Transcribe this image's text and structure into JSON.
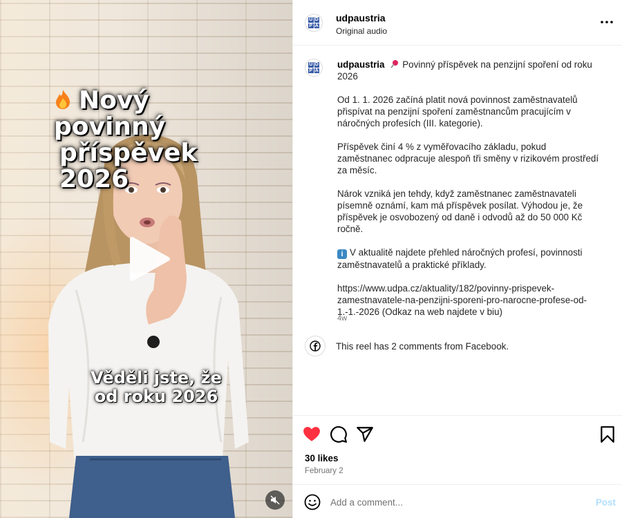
{
  "media": {
    "overlay_title_line1": "Nový povinný",
    "overlay_title_line2": "příspěvek 2026",
    "overlay_caption": "Věděli jste, že od roku 2026",
    "play_icon": "play-icon",
    "mute_icon": "muted-speaker-icon"
  },
  "header": {
    "username": "udpaustria",
    "audio": "Original audio",
    "avatar_letters": [
      "U",
      "D",
      "P",
      "A"
    ]
  },
  "caption": {
    "username": "udpaustria",
    "headline": "Povinný příspěvek na penzijní spoření od roku 2026",
    "paragraph1": "Od 1. 1. 2026 začíná platit nová povinnost zaměstnavatelů přispívat na penzijní spoření zaměstnancům pracujícím v náročných profesích (III. kategorie).",
    "paragraph2": "Příspěvek činí 4 % z vyměřovacího základu, pokud zaměstnanec odpracuje alespoň tři směny v rizikovém prostředí za měsíc.",
    "paragraph3": "Nárok vzniká jen tehdy, když zaměstnanec zaměstnavateli písemně oznámí, kam má příspěvek posílat. Výhodou je, že příspěvek je osvobozený od daně i odvodů až do 50 000 Kč ročně.",
    "paragraph4": "V aktualitě najdete přehled náročných profesí, povinnosti zaměstnavatelů a praktické příklady.",
    "paragraph5": "https://www.udpa.cz/aktuality/182/povinny-prispevek-zamestnavatele-na-penzijni-sporeni-pro-narocne-profese-od-1.-1.-2026 (Odkaz na web najdete v biu)",
    "age": "4w",
    "info_glyph": "i"
  },
  "facebook": {
    "text": "This reel has 2 comments from Facebook."
  },
  "actions": {
    "likes": "30 likes",
    "date": "February 2",
    "liked": true,
    "like_color": "#ff3040"
  },
  "comment": {
    "placeholder": "Add a comment...",
    "post_label": "Post"
  }
}
